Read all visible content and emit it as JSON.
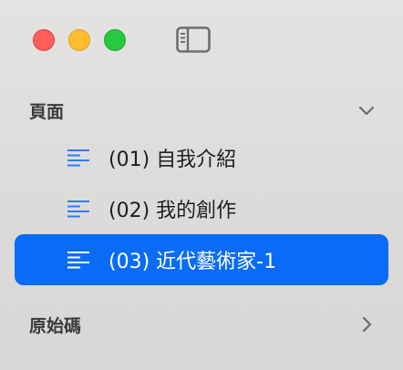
{
  "window": {
    "controls": [
      "close",
      "minimize",
      "zoom"
    ],
    "toolbar_icon": "sidebar-toggle-icon"
  },
  "sidebar": {
    "sections": [
      {
        "label": "頁面",
        "expanded": true,
        "disclosure_icon": "chevron-down-icon",
        "items": [
          {
            "label": "(01) 自我介紹",
            "icon": "text-lines-icon",
            "selected": false
          },
          {
            "label": "(02) 我的創作",
            "icon": "text-lines-icon",
            "selected": false
          },
          {
            "label": "(03) 近代藝術家-1",
            "icon": "text-lines-icon",
            "selected": true
          }
        ]
      },
      {
        "label": "原始碼",
        "expanded": false,
        "disclosure_icon": "chevron-right-icon"
      }
    ]
  },
  "colors": {
    "accent": "#0a6cf6",
    "icon_blue": "#2d7cf6",
    "close": "#fe5f57",
    "minimize": "#febc2e",
    "zoom": "#28c840"
  }
}
